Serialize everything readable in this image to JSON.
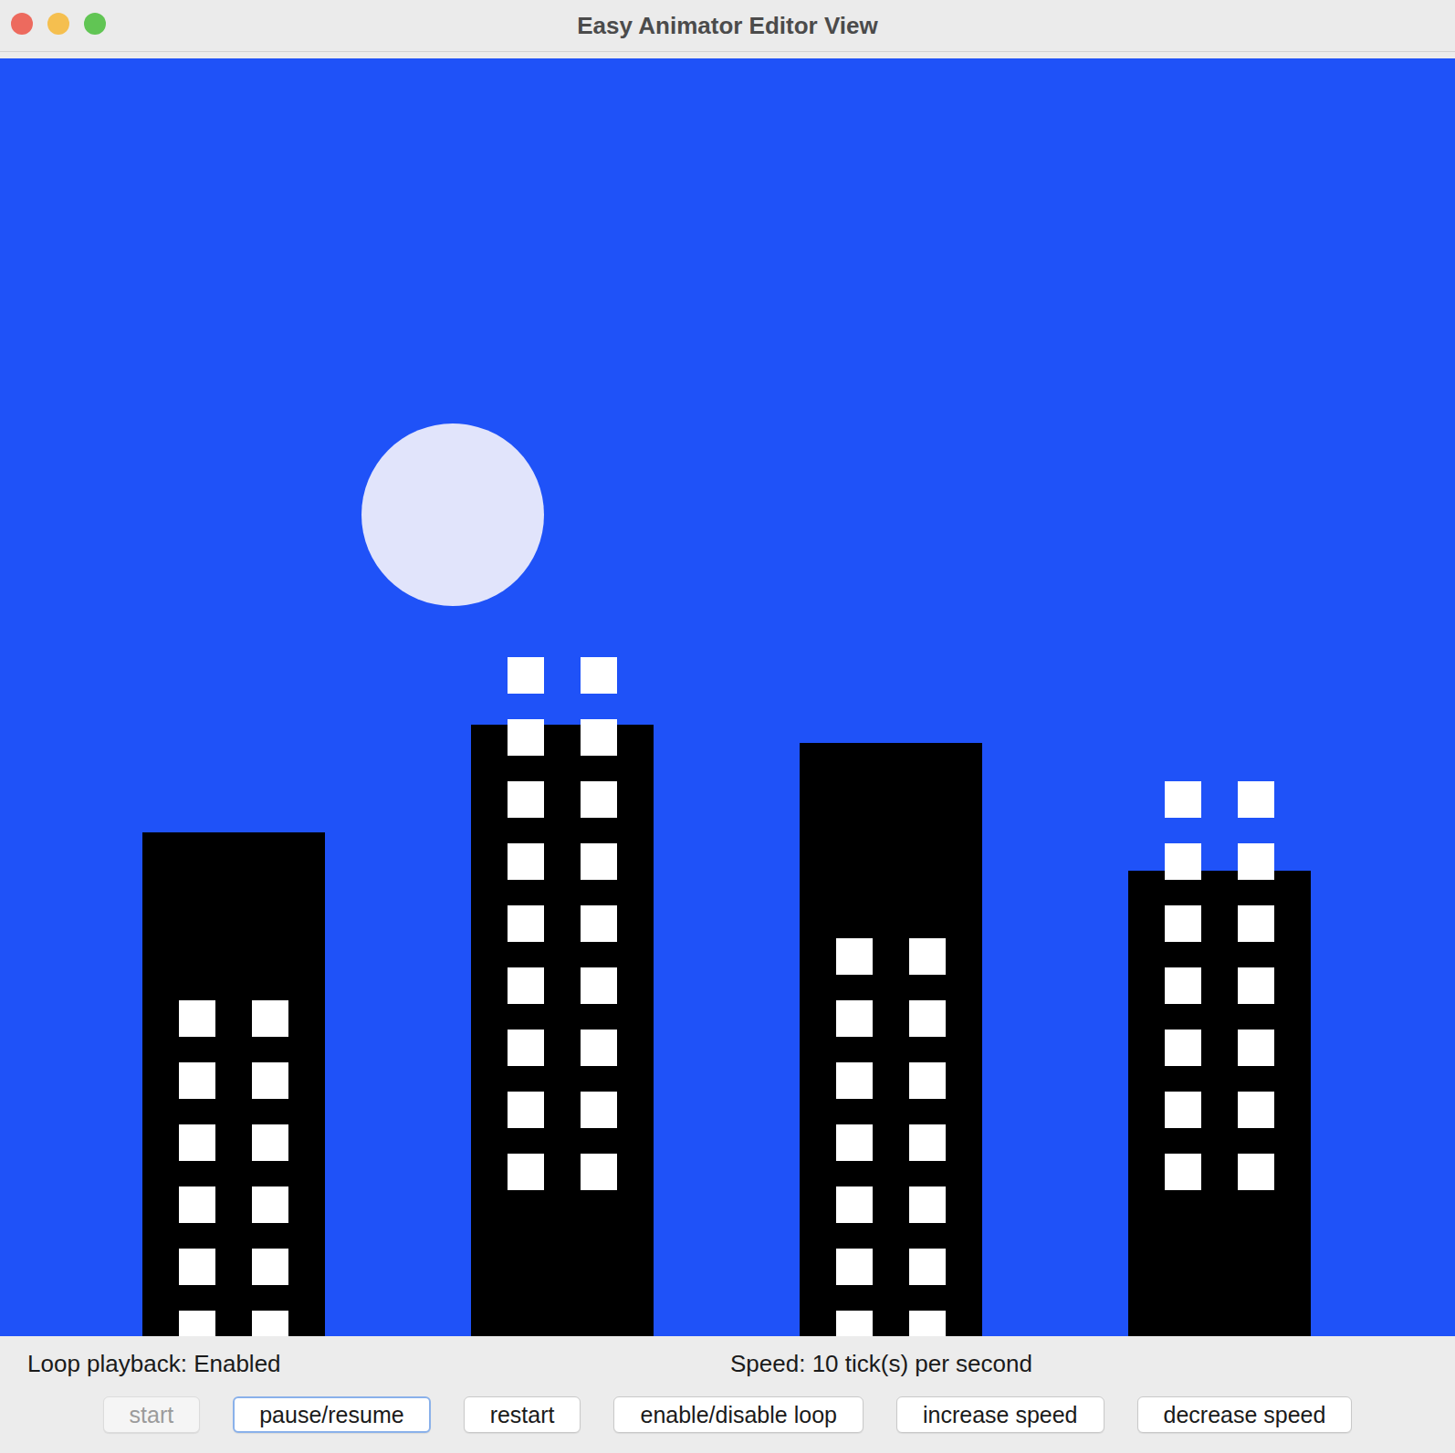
{
  "window": {
    "title": "Easy Animator Editor View"
  },
  "status": {
    "loop": "Loop playback: Enabled",
    "speed": "Speed: 10 tick(s) per second"
  },
  "buttons": [
    {
      "label": "start",
      "disabled": true,
      "focused": false
    },
    {
      "label": "pause/resume",
      "disabled": false,
      "focused": true
    },
    {
      "label": "restart",
      "disabled": false,
      "focused": false
    },
    {
      "label": "enable/disable loop",
      "disabled": false,
      "focused": false
    },
    {
      "label": "increase speed",
      "disabled": false,
      "focused": false
    },
    {
      "label": "decrease speed",
      "disabled": false,
      "focused": false
    }
  ]
}
